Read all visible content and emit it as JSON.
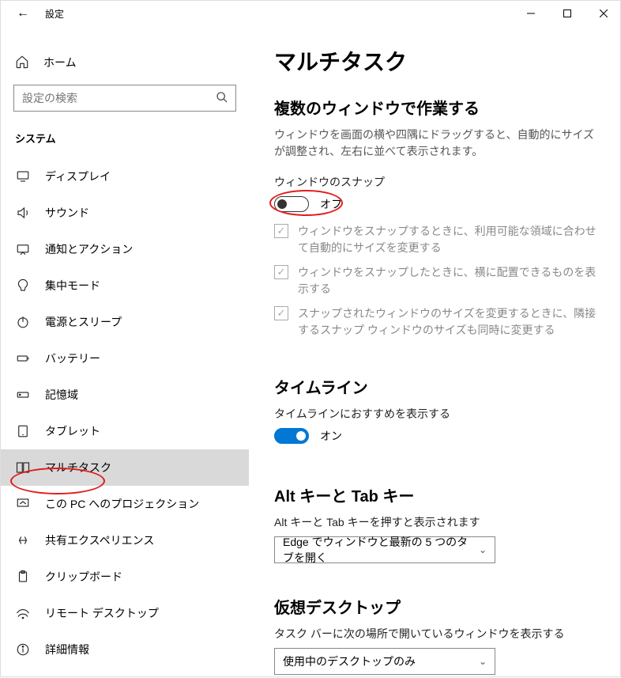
{
  "window": {
    "title": "設定",
    "back_icon": "←"
  },
  "sidebar": {
    "home": "ホーム",
    "search_placeholder": "設定の検索",
    "system_header": "システム",
    "items": [
      {
        "icon": "display",
        "label": "ディスプレイ"
      },
      {
        "icon": "sound",
        "label": "サウンド"
      },
      {
        "icon": "notify",
        "label": "通知とアクション"
      },
      {
        "icon": "focus",
        "label": "集中モード"
      },
      {
        "icon": "power",
        "label": "電源とスリープ"
      },
      {
        "icon": "battery",
        "label": "バッテリー"
      },
      {
        "icon": "storage",
        "label": "記憶域"
      },
      {
        "icon": "tablet",
        "label": "タブレット"
      },
      {
        "icon": "multitask",
        "label": "マルチタスク",
        "selected": true
      },
      {
        "icon": "project",
        "label": "この PC へのプロジェクション"
      },
      {
        "icon": "shared",
        "label": "共有エクスペリエンス"
      },
      {
        "icon": "clipboard",
        "label": "クリップボード"
      },
      {
        "icon": "remote",
        "label": "リモート デスクトップ"
      },
      {
        "icon": "about",
        "label": "詳細情報"
      }
    ]
  },
  "page": {
    "title": "マルチタスク",
    "sec_windows": {
      "title": "複数のウィンドウで作業する",
      "desc": "ウィンドウを画面の横や四隅にドラッグすると、自動的にサイズが調整され、左右に並べて表示されます。",
      "snap_label": "ウィンドウのスナップ",
      "snap_state_label": "オフ",
      "snap_on": false,
      "chk1": "ウィンドウをスナップするときに、利用可能な領域に合わせて自動的にサイズを変更する",
      "chk2": "ウィンドウをスナップしたときに、横に配置できるものを表示する",
      "chk3": "スナップされたウィンドウのサイズを変更するときに、隣接するスナップ ウィンドウのサイズも同時に変更する"
    },
    "sec_timeline": {
      "title": "タイムライン",
      "desc": "タイムラインにおすすめを表示する",
      "state_label": "オン",
      "on": true
    },
    "sec_alttab": {
      "title": "Alt キーと Tab キー",
      "desc": "Alt キーと Tab キーを押すと表示されます",
      "value": "Edge でウィンドウと最新の 5 つのタブを開く"
    },
    "sec_vdesktop": {
      "title": "仮想デスクトップ",
      "desc": "タスク バーに次の場所で開いているウィンドウを表示する",
      "value": "使用中のデスクトップのみ"
    }
  }
}
